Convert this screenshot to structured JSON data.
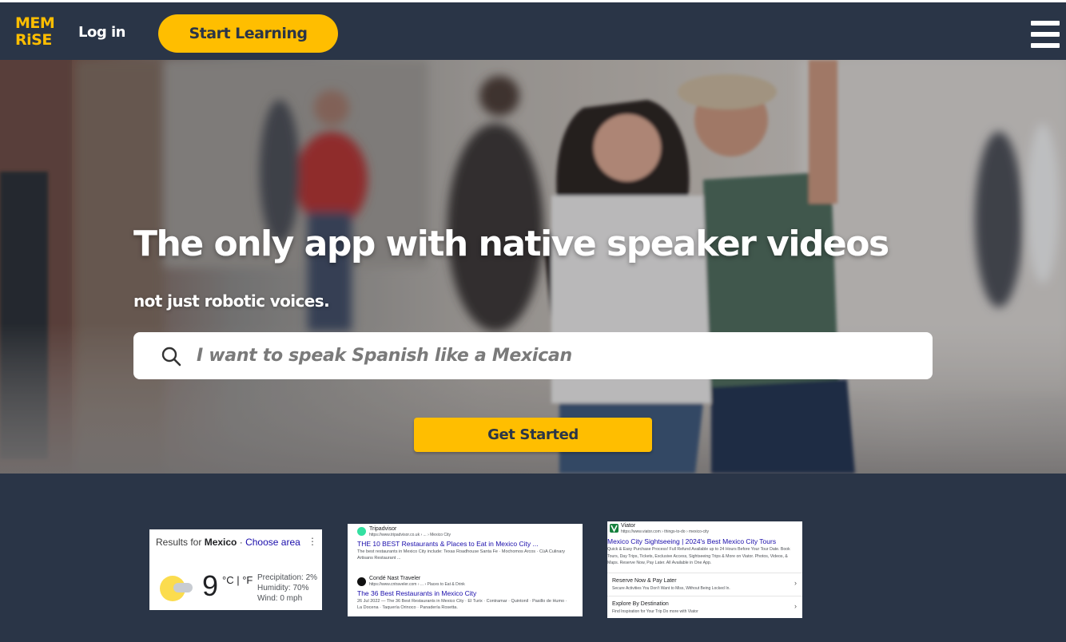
{
  "header": {
    "logo_line1": "MEM",
    "logo_line2": "RiSE",
    "login_label": "Log in",
    "start_learning_label": "Start Learning",
    "menu_icon": "hamburger-menu-icon"
  },
  "hero": {
    "headline": "The only app with native speaker videos",
    "subline": "not just robotic voices.",
    "search_placeholder": "I want to speak Spanish like a Mexican",
    "search_icon": "search-icon",
    "get_started_label": "Get Started"
  },
  "cards": {
    "weather": {
      "results_for": "Results for",
      "location": "Mexico",
      "sep": "·",
      "choose_area": "Choose area",
      "menu_dots": "⋮",
      "temperature": "9",
      "units": "°C | °F",
      "precipitation": "Precipitation: 2%",
      "humidity": "Humidity: 70%",
      "wind": "Wind: 0 mph"
    },
    "restaurants": {
      "r1_site": "Tripadvisor",
      "r1_url": "https://www.tripadvisor.co.uk › ... › Mexico City",
      "r1_title": "THE 10 BEST Restaurants & Places to Eat in Mexico City ...",
      "r1_snippet": "The best restaurants in Mexico City include: Texas Roadhouse Santa Fe · Mochomos Arcos · CüA Culinary Artisans Restaurant ...",
      "r2_site": "Condé Nast Traveler",
      "r2_url": "https://www.cntraveler.com › ... › Places to Eat & Drink",
      "r2_title": "The 36 Best Restaurants in Mexico City",
      "r2_snippet": "26 Jul 2022 — The 36 Best Restaurants in Mexico City · El Turix · Contramar · Quintonil · Pasillo de Humo · La Docena · Taquería Orinoco · Panadería Rosetta."
    },
    "viator": {
      "site": "Viator",
      "url": "https://www.viator.com › things-to-do › mexico-city",
      "title": "Mexico City Sightseeing | 2024's Best Mexico City Tours",
      "snippet": "Quick & Easy Purchase Process! Full Refund Available up to 24 Hours Before Your Tour Date. Book Tours, Day Trips, Tickets, Exclusive Access, Sightseeing Trips & More on Viator. Photos, Videos, & Maps. Reserve Now, Pay Later. All Available in One App.",
      "row1_title": "Reserve Now & Pay Later",
      "row1_sub": "Secure Activities You Don't Want to Miss, Without Being Locked In.",
      "row2_title": "Explore By Destination",
      "row2_sub": "Find Inspiration for Your Trip Do more with Viator",
      "chevron": "›"
    }
  },
  "colors": {
    "navy": "#2a3547",
    "accent_yellow": "#ffbe00",
    "link_blue": "#1a0dab"
  }
}
